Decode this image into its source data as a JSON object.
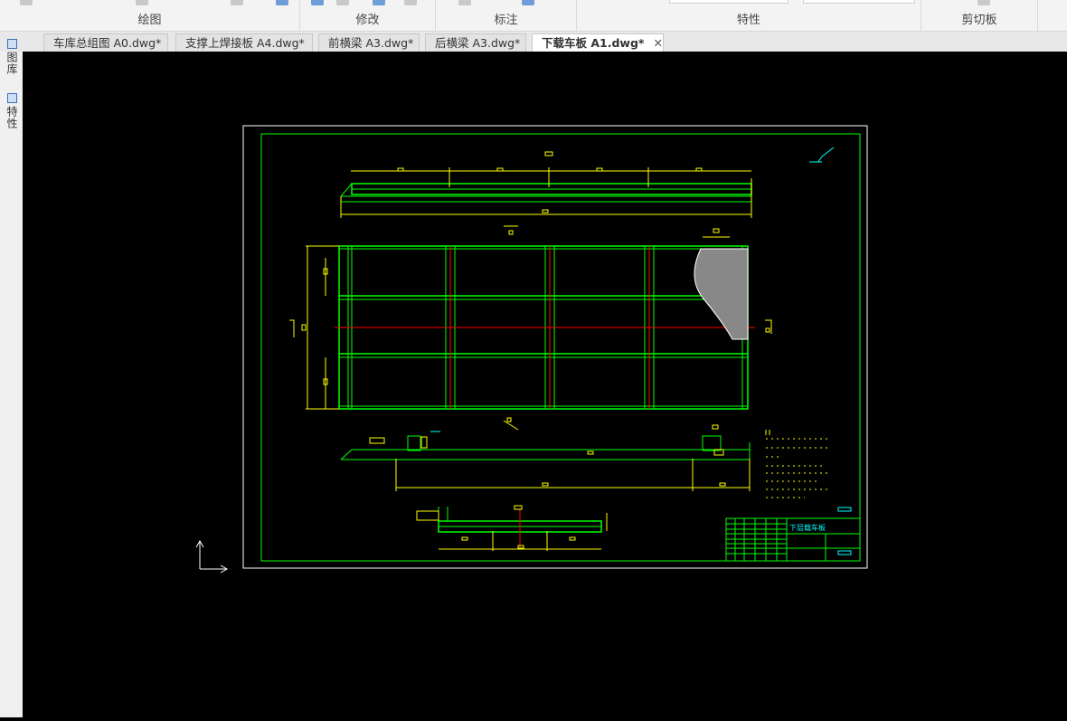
{
  "ribbon": {
    "groups": [
      {
        "label": "绘图"
      },
      {
        "label": "修改"
      },
      {
        "label": "标注"
      },
      {
        "label": "特性"
      },
      {
        "label": "剪切板"
      }
    ]
  },
  "tabs": [
    {
      "label": "车库总组图 A0.dwg*",
      "active": false
    },
    {
      "label": "支撑上焊接板 A4.dwg*",
      "active": false
    },
    {
      "label": "前横梁 A3.dwg*",
      "active": false
    },
    {
      "label": "后横梁 A3.dwg*",
      "active": false
    },
    {
      "label": "下载车板 A1.dwg*",
      "active": true
    }
  ],
  "tab_close_glyph": "✕",
  "side_panels": [
    {
      "label": "图库"
    },
    {
      "label": "特性"
    }
  ],
  "drawing": {
    "title_block_name": "下层载车板",
    "colors": {
      "background": "#000000",
      "frame": "#ffffff",
      "border": "#00ff00",
      "geometry": "#00ff00",
      "dimension": "#ffff00",
      "centerline": "#ff0000",
      "title_text": "#00ffff"
    }
  }
}
